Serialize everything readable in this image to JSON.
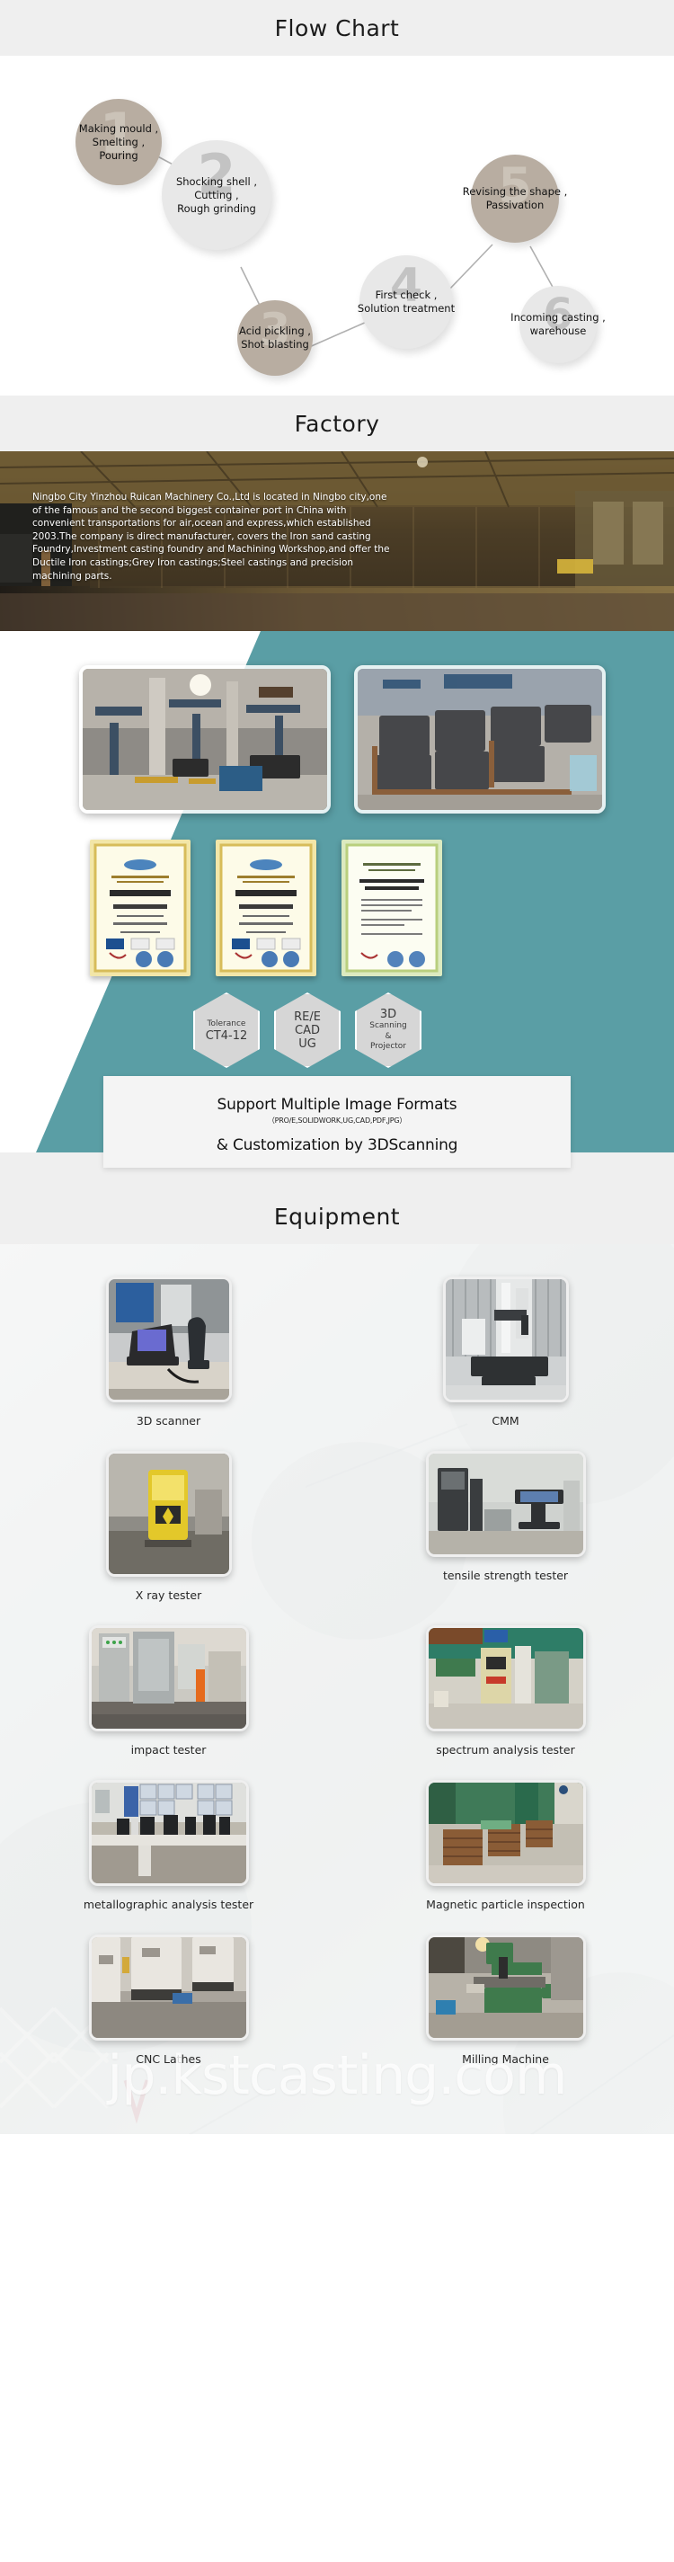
{
  "sections": {
    "flow_chart": {
      "title": "Flow Chart"
    },
    "factory": {
      "title": "Factory"
    },
    "equipment": {
      "title": "Equipment"
    }
  },
  "flow_chart": {
    "nodes": [
      {
        "num": "1",
        "style": "tan",
        "lines": [
          "Making mould ,",
          "Smelting ,",
          "Pouring"
        ]
      },
      {
        "num": "2",
        "style": "gray",
        "lines": [
          "Shocking shell ,",
          "Cutting ,",
          "Rough grinding"
        ]
      },
      {
        "num": "3",
        "style": "tan",
        "lines": [
          "Acid pickling ,",
          "Shot blasting"
        ]
      },
      {
        "num": "4",
        "style": "gray",
        "lines": [
          "First check ,",
          "Solution treatment"
        ]
      },
      {
        "num": "5",
        "style": "tan",
        "lines": [
          "Revising the shape ,",
          "Passivation"
        ]
      },
      {
        "num": "6",
        "style": "gray",
        "lines": [
          "Incoming casting ,",
          "warehouse"
        ]
      }
    ]
  },
  "factory": {
    "description": "Ningbo City Yinzhou Ruican Machinery Co.,Ltd is located in Ningbo city,one of the famous and the second biggest container port in China with convenient transportations for air,ocean and express,which established 2003.The company is direct manufacturer, covers the  Iron sand casting Foundry,Investment casting foundry and Machining Workshop,and offer the Ductile Iron castings;Grey Iron castings;Steel castings and precision machining parts.",
    "hexagons": [
      {
        "lines": [
          "Tolerance",
          "CT4-12"
        ]
      },
      {
        "lines": [
          "RE/E",
          "CAD",
          "UG"
        ]
      },
      {
        "lines": [
          "3D",
          "Scanning",
          "&",
          "Projector"
        ]
      }
    ],
    "formats": {
      "headline": "Support Multiple Image Formats",
      "subline": "（PRO/E,SOLIDWORK,UG,CAD,PDF,JPG）",
      "tagline": "& Customization by 3DScanning"
    }
  },
  "equipment": {
    "items": [
      {
        "label": "3D scanner"
      },
      {
        "label": "CMM"
      },
      {
        "label": "X ray tester"
      },
      {
        "label": "tensile strength tester"
      },
      {
        "label": "impact tester"
      },
      {
        "label": "spectrum analysis tester"
      },
      {
        "label": "metallographic analysis tester"
      },
      {
        "label": "Magnetic particle inspection"
      },
      {
        "label": "CNC Lathes"
      },
      {
        "label": "Milling Machine"
      }
    ]
  },
  "watermark": {
    "text": "jp.kstcasting.com"
  },
  "colors": {
    "header_bg": "#efefef",
    "teal": "#5a9ea5",
    "tan_node": "#b8ada1",
    "gray_node": "#e8e8e8"
  }
}
